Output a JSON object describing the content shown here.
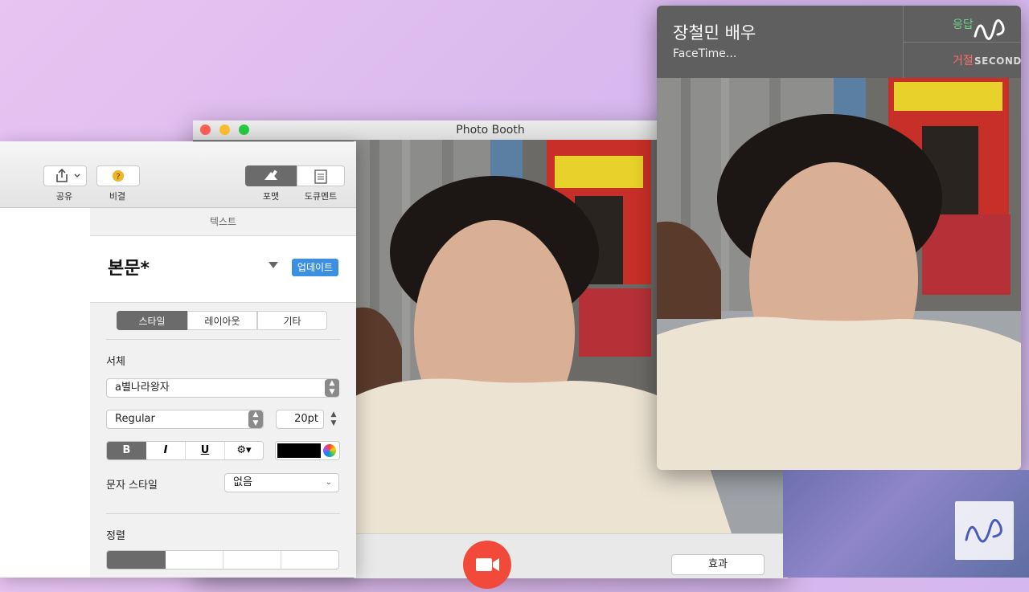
{
  "photo_booth": {
    "title": "Photo Booth",
    "effects_label": "효과",
    "traffic_lights": [
      "#fe5f57",
      "#febc2e",
      "#28c840"
    ]
  },
  "pages": {
    "toolbar": {
      "share_label": "공유",
      "tips_label": "비결",
      "format_label": "포맷",
      "document_label": "도큐멘트"
    },
    "inspector": {
      "header": "텍스트",
      "paragraph_style": "본문*",
      "update_label": "업데이트",
      "tabs": [
        "스타일",
        "레이아웃",
        "기타"
      ],
      "font_section": "서체",
      "font_family": "a별나라왕자",
      "font_typeface": "Regular",
      "font_size": "20pt",
      "bold": "B",
      "italic": "I",
      "underline": "U",
      "char_style_label": "문자 스타일",
      "char_style_value": "없음",
      "align_section": "정렬",
      "text_color": "#000000"
    }
  },
  "facetime": {
    "caller": "장철민 배우",
    "status": "FaceTime...",
    "accept_label": "응답",
    "decline_label": "거절"
  },
  "watermark": {
    "text": "SECONDS"
  },
  "colors": {
    "accent_blue": "#3d8fe0",
    "record_red": "#f24a3a",
    "accept_green": "#6fd08a",
    "decline_red": "#ff6b6b"
  }
}
